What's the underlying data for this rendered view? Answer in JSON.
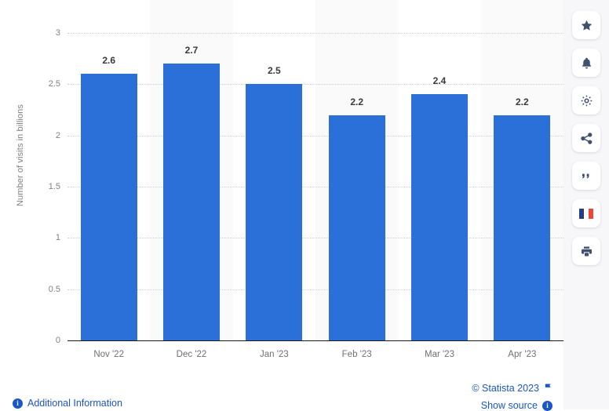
{
  "chart_data": {
    "type": "bar",
    "title": "",
    "xlabel": "",
    "ylabel": "Number of visits in billions",
    "categories": [
      "Nov '22",
      "Dec '22",
      "Jan '23",
      "Feb '23",
      "Mar '23",
      "Apr '23"
    ],
    "values": [
      2.6,
      2.7,
      2.5,
      2.2,
      2.4,
      2.2
    ],
    "value_labels": [
      "2.6",
      "2.7",
      "2.5",
      "2.2",
      "2.4",
      "2.2"
    ],
    "ylim": [
      0,
      3
    ],
    "yticks": [
      0,
      0.5,
      1,
      1.5,
      2,
      2.5,
      3
    ],
    "ytick_labels": [
      "0",
      "0.5",
      "1",
      "1.5",
      "2",
      "2.5",
      "3"
    ],
    "grid": true,
    "legend": "none",
    "bar_color": "#2a70d8"
  },
  "footer": {
    "additional_information": "Additional Information",
    "copyright": "© Statista 2023",
    "show_source": "Show source",
    "info_glyph": "i"
  },
  "sidebar": {
    "items": [
      {
        "name": "favorite-star",
        "label": ""
      },
      {
        "name": "notification-bell",
        "label": ""
      },
      {
        "name": "settings-gear",
        "label": ""
      },
      {
        "name": "share",
        "label": ""
      },
      {
        "name": "citation-quote",
        "label": ""
      },
      {
        "name": "language-french-flag",
        "label": ""
      },
      {
        "name": "print",
        "label": ""
      }
    ]
  }
}
